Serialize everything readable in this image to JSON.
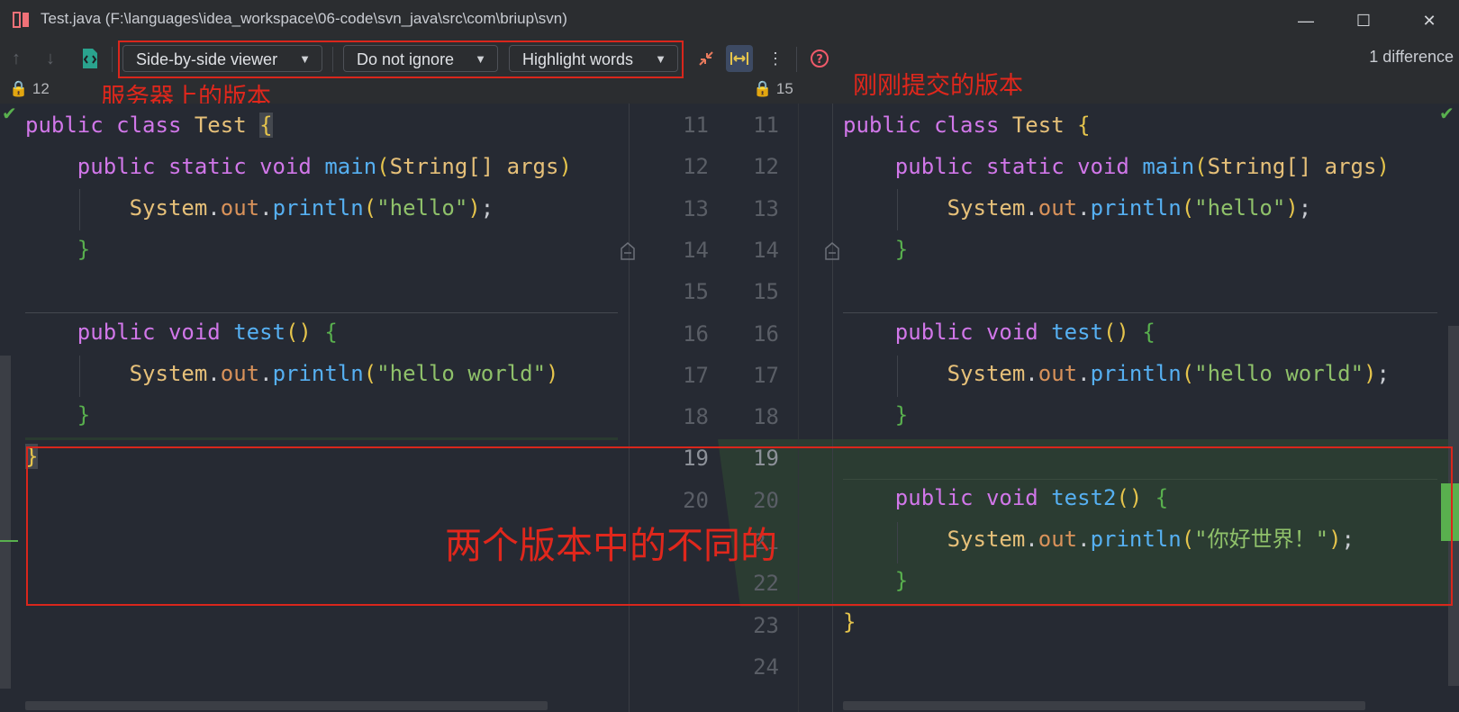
{
  "window": {
    "title": "Test.java (F:\\languages\\idea_workspace\\06-code\\svn_java\\src\\com\\briup\\svn)",
    "minimize": "—",
    "maximize": "☐",
    "close": "✕"
  },
  "toolbar": {
    "viewer": "Side-by-side viewer",
    "ignore": "Do not ignore",
    "highlight": "Highlight words",
    "difference_count": "1 difference"
  },
  "left_panel": {
    "revision": "12"
  },
  "right_panel": {
    "revision": "15"
  },
  "annotations": {
    "server_version": "服务器上的版本",
    "just_committed": "刚刚提交的版本",
    "difference": "两个版本中的不同的"
  },
  "left_line_numbers": [
    "11",
    "12",
    "13",
    "14",
    "15",
    "16",
    "17",
    "18",
    "19",
    "20"
  ],
  "right_line_numbers": [
    "11",
    "12",
    "13",
    "14",
    "15",
    "16",
    "17",
    "18",
    "19",
    "20",
    "21",
    "22",
    "23",
    "24"
  ],
  "colors": {
    "accent_red": "#d9261c",
    "added_green": "#2b3c32",
    "keyword": "#d177e9",
    "string": "#8fc16a"
  }
}
